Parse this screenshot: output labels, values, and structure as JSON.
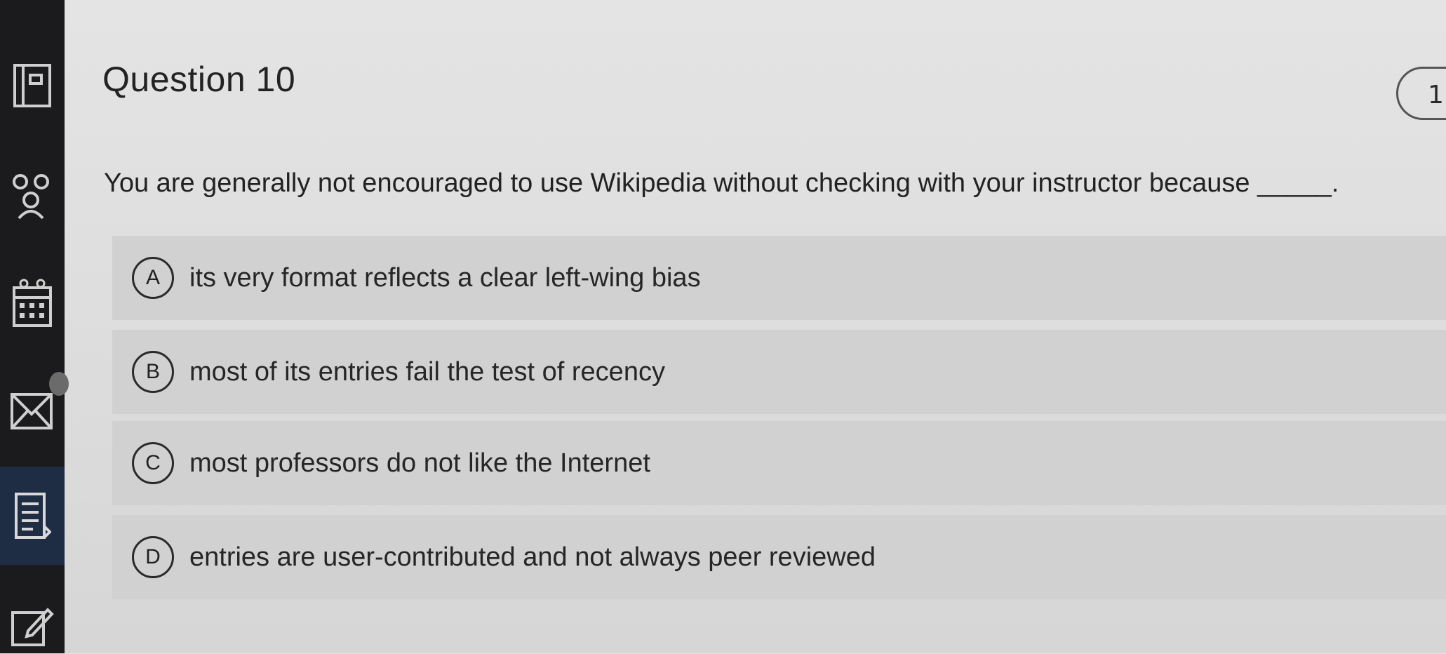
{
  "question": {
    "title": "Question 10",
    "points_badge": "1",
    "prompt": "You are generally not encouraged to use Wikipedia without checking with your instructor because _____.",
    "options": [
      {
        "letter": "A",
        "text": "its very format reflects a clear left-wing bias"
      },
      {
        "letter": "B",
        "text": "most of its entries fail the test of recency"
      },
      {
        "letter": "C",
        "text": "most professors do not like the Internet"
      },
      {
        "letter": "D",
        "text": "entries are user-contributed and not always peer reviewed"
      }
    ]
  },
  "sidebar": {
    "icons": [
      "course-home-icon",
      "people-icon",
      "calendar-icon",
      "inbox-icon",
      "assignments-icon",
      "edit-icon"
    ]
  },
  "colors": {
    "sidebar": "#1b1b1d",
    "sidebar_active": "#1e2c44",
    "option_bg": "#d1d1d1",
    "page_bg": "#e0e0e0"
  }
}
